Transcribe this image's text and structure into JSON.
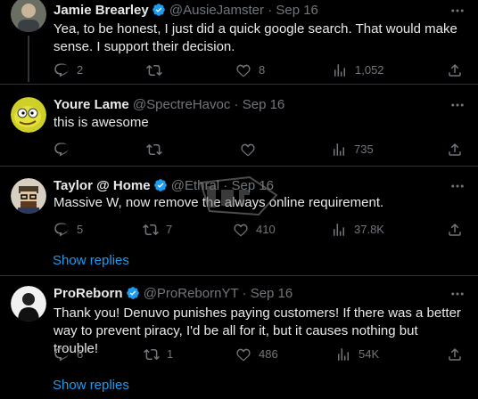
{
  "tweets": [
    {
      "name": "Jamie Brearley",
      "handle": "@AusieJamster",
      "sep": "·",
      "date": "Sep 16",
      "verified": true,
      "text": "Yea, to be honest, I just did a quick google search. That would make sense. I support their decision.",
      "replies": "2",
      "retweets": "",
      "likes": "8",
      "views": "1,052"
    },
    {
      "name": "Youre Lame",
      "handle": "@SpectreHavoc",
      "sep": "·",
      "date": "Sep 16",
      "verified": false,
      "text": "this is awesome",
      "replies": "",
      "retweets": "",
      "likes": "",
      "views": "735"
    },
    {
      "name": "Taylor @ Home",
      "handle": "@Ethral",
      "sep": "·",
      "date": "Sep 16",
      "verified": true,
      "text": "Massive W, now remove the always online requirement.",
      "replies": "5",
      "retweets": "7",
      "likes": "410",
      "views": "37.8K",
      "show_replies": "Show replies"
    },
    {
      "name": "ProReborn",
      "handle": "@ProRebornYT",
      "sep": "·",
      "date": "Sep 16",
      "verified": true,
      "text": "Thank you! Denuvo punishes paying customers! If there was a better way to prevent piracy, I'd be all for it, but it causes nothing but trouble!",
      "replies": "6",
      "retweets": "1",
      "likes": "486",
      "views": "54K",
      "show_replies": "Show replies"
    }
  ],
  "colors": {
    "background": "#000000",
    "text": "#e7e9ea",
    "muted": "#71767b",
    "accent": "#1d9bf0",
    "divider": "#2f3336"
  },
  "icons": [
    "reply-icon",
    "retweet-icon",
    "like-icon",
    "views-icon",
    "share-icon",
    "more-icon",
    "verified-icon"
  ]
}
